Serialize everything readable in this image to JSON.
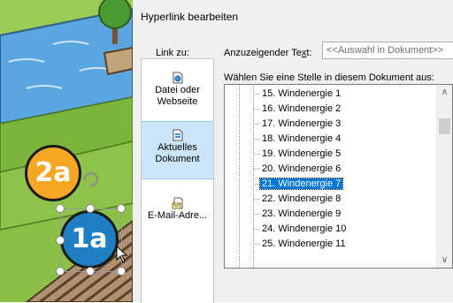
{
  "dialog": {
    "title": "Hyperlink bearbeiten",
    "link_to_label": "Link zu:",
    "display_text_label": "Anzuzeigender Text:",
    "display_text_value": "<<Auswahl in Dokument>>",
    "choose_label": "Wählen Sie eine Stelle in diesem Dokument aus:",
    "nav": [
      {
        "label_line1": "Datei oder",
        "label_line2": "Webseite",
        "icon": "file-web-icon"
      },
      {
        "label_line1": "Aktuelles",
        "label_line2": "Dokument",
        "icon": "current-document-icon",
        "selected": true
      },
      {
        "label_line1": "E-Mail-Adre...",
        "label_line2": "",
        "icon": "email-icon"
      }
    ],
    "tree_items": [
      "15. Windenergie 1",
      "16. Windenergie 2",
      "17. Windenergie 3",
      "18. Windenergie 4",
      "19. Windenergie 5",
      "20. Windenergie 6",
      "21. Windenergie 7",
      "22. Windenergie 8",
      "23. Windenergie 9",
      "24. Windenergie 10",
      "25. Windenergie 11"
    ],
    "selected_item": "21. Windenergie 7",
    "scroll_up_glyph": "∧",
    "scroll_down_glyph": "∨"
  },
  "slide": {
    "badge_2a": "2a",
    "badge_1a": "1a",
    "colors": {
      "badge_2a": "#f5a623",
      "badge_1a": "#1f7fc4",
      "grass": "#8bbf45",
      "river": "#5aa6e0",
      "field": "#8a6a4a"
    }
  }
}
